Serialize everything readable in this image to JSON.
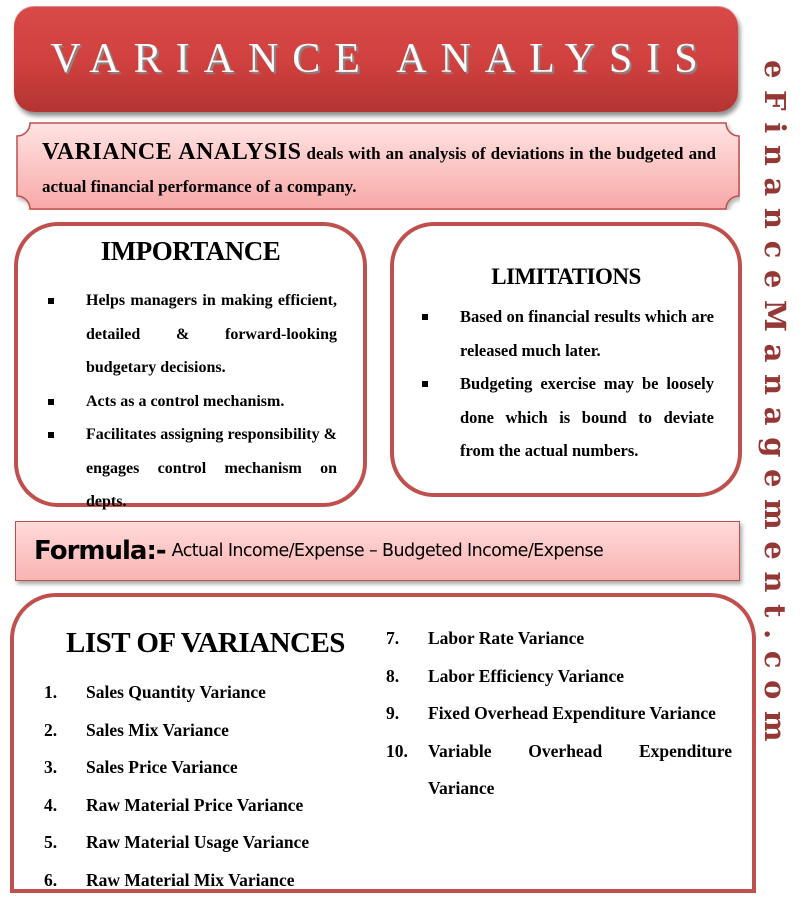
{
  "title": "VARIANCE ANALYSIS",
  "definition": {
    "lead": "VARIANCE ANALYSIS",
    "text": " deals with an analysis of deviations in the budgeted and actual financial performance of a company."
  },
  "importance": {
    "heading": "IMPORTANCE",
    "items": [
      "Helps managers in making efficient, detailed & forward-looking budgetary decisions.",
      "Acts as a control mechanism.",
      "Facilitates assigning responsibility & engages control mechanism on depts."
    ]
  },
  "limitations": {
    "heading": "LIMITATIONS",
    "items": [
      "Based on financial results which are released much later.",
      "Budgeting exercise may be loosely done which is bound to deviate from the actual numbers."
    ]
  },
  "formula": {
    "label": "Formula:-",
    "value": "Actual Income/Expense – Budgeted Income/Expense"
  },
  "variances": {
    "heading": "LIST OF VARIANCES",
    "items": [
      {
        "num": "1.",
        "label": "Sales Quantity Variance"
      },
      {
        "num": "2.",
        "label": "Sales Mix Variance"
      },
      {
        "num": "3.",
        "label": "Sales Price Variance"
      },
      {
        "num": "4.",
        "label": "Raw Material Price Variance"
      },
      {
        "num": "5.",
        "label": "Raw Material Usage Variance"
      },
      {
        "num": "6.",
        "label": "Raw Material Mix Variance"
      },
      {
        "num": "7.",
        "label": "Labor Rate Variance"
      },
      {
        "num": "8.",
        "label": "Labor Efficiency Variance"
      },
      {
        "num": "9.",
        "label": "Fixed Overhead Expenditure Variance"
      },
      {
        "num": "10.",
        "label": "Variable Overhead Expenditure Variance"
      }
    ]
  },
  "watermark": "eFinanceManagement.com",
  "colors": {
    "title_red": "#cf403e",
    "border_red": "#c0504d",
    "pink_fill": "#f9b4b2",
    "watermark": "#953735"
  }
}
